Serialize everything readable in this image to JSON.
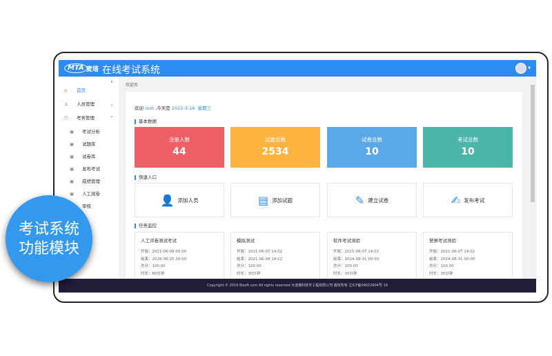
{
  "header": {
    "logo": "MTA",
    "logo_cn": "麦塔",
    "title": "在线考试系统"
  },
  "sidebar": {
    "items": [
      {
        "label": "首页",
        "icon": "home-icon",
        "active": true
      },
      {
        "label": "人员管理",
        "icon": "user-icon",
        "chevron": "⌄"
      },
      {
        "label": "考务管理",
        "icon": "exam-icon",
        "chevron": "⌃"
      },
      {
        "label": "考试分析",
        "icon": "analysis-icon",
        "sub": true
      },
      {
        "label": "试题库",
        "icon": "question-bank-icon",
        "sub": true
      },
      {
        "label": "试卷库",
        "icon": "paper-bank-icon",
        "sub": true
      },
      {
        "label": "发布考试",
        "icon": "publish-icon",
        "sub": true
      },
      {
        "label": "成绩管理",
        "icon": "score-icon",
        "sub": true
      },
      {
        "label": "人工阅卷",
        "icon": "grading-icon",
        "sub": true
      },
      {
        "label": "审核",
        "icon": "review-icon",
        "sub": true
      }
    ]
  },
  "breadcrumb": "欢迎页",
  "welcome": {
    "prefix": "欢迎",
    "user": "root",
    "mid": ",今天是",
    "date": "2022-3-16",
    "weekday": "星期三"
  },
  "sections": {
    "basic": "基本数据",
    "quick": "快速入口",
    "tasks": "任务监控"
  },
  "stats": [
    {
      "label": "注册人数",
      "value": "44",
      "color": "#ee5f66"
    },
    {
      "label": "试题总数",
      "value": "2534",
      "color": "#ffb340"
    },
    {
      "label": "试卷总数",
      "value": "10",
      "color": "#5aa8e8"
    },
    {
      "label": "考试总数",
      "value": "10",
      "color": "#4bb5a8"
    }
  ],
  "quick": [
    {
      "label": "添加人员",
      "icon": "add-user-icon"
    },
    {
      "label": "添加试题",
      "icon": "add-question-icon"
    },
    {
      "label": "建立试卷",
      "icon": "create-paper-icon"
    },
    {
      "label": "发布考试",
      "icon": "publish-exam-icon"
    }
  ],
  "tasks": [
    {
      "title": "人工评卷测试考试",
      "start": "开始：2021-06-08 00:00",
      "end": "结束：2026-06-25 20:00",
      "score": "总分：100.00",
      "duration": "时长：60分钟"
    },
    {
      "title": "模拟测试",
      "start": "开始：2021-06-07 14:02",
      "end": "结束：2021-06-08 18:02",
      "score": "总分：100.00",
      "duration": "时长：30分钟"
    },
    {
      "title": "软件考试测验",
      "start": "开始：2021-06-07 14:02",
      "end": "结束：2024-08-31 00:00",
      "score": "总分：100.00",
      "duration": "时长：30分钟"
    },
    {
      "title": "警察考试测验",
      "start": "开始：2021-06-07 14:02",
      "end": "结束：2024-08-31 00:00",
      "score": "总分：100.00",
      "duration": "时长：30分钟"
    }
  ],
  "footer": "Copyright © 2019 Bisoft.com All rights reserved 大连格科软件工程有限公司 版权所有 辽ICP备09022904号-19",
  "badge": {
    "line1": "考试系统",
    "line2": "功能模块"
  }
}
